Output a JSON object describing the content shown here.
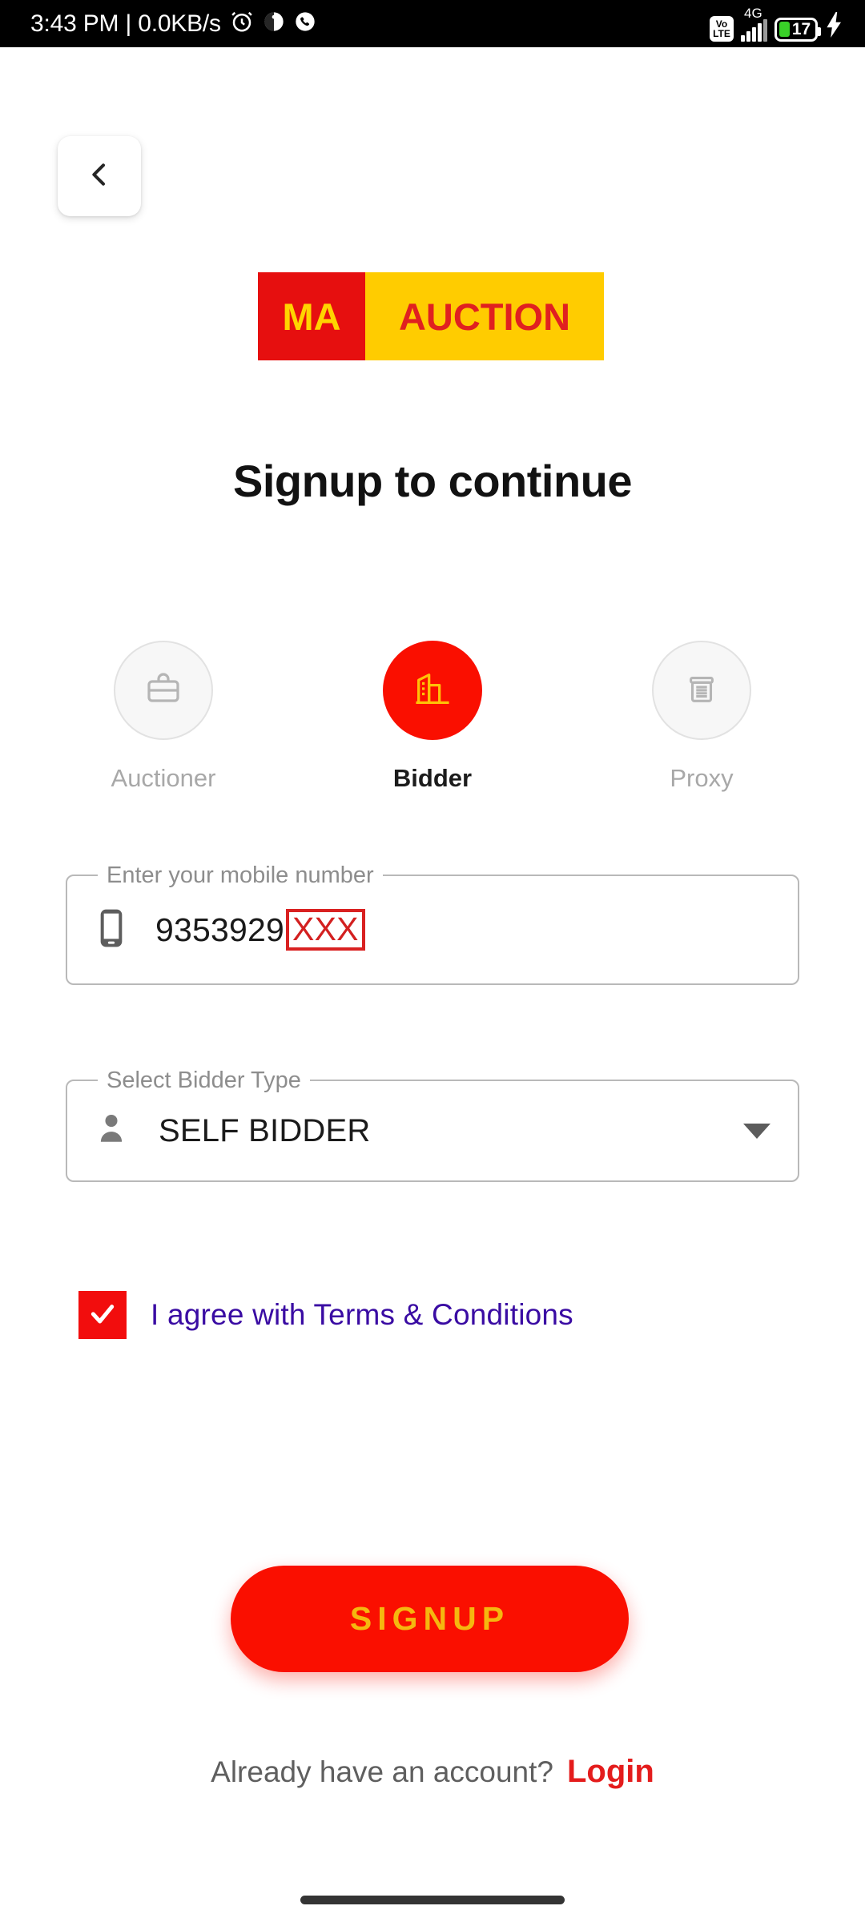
{
  "status_bar": {
    "time": "3:43 PM",
    "separator": "|",
    "network_speed": "0.0KB/s",
    "icons_left": [
      "alarm-icon",
      "sound-mode-icon",
      "phone-call-icon"
    ],
    "volte_top": "Vo",
    "volte_bottom": "LTE",
    "network_type": "4G",
    "battery_percent": "17",
    "battery_charging": true,
    "background": "#000000",
    "foreground": "#ffffff",
    "battery_fill_color": "#39d128"
  },
  "nav": {
    "back_icon": "chevron-left-icon"
  },
  "brand": {
    "logo_left_text": "MA",
    "logo_right_text": "AUCTION",
    "logo_left_bg": "#e60f0f",
    "logo_left_fg": "#ffd400",
    "logo_right_bg": "#ffcc00",
    "logo_right_fg": "#e02020"
  },
  "header": {
    "title": "Signup to continue"
  },
  "role_selector": {
    "selected": "Bidder",
    "accent_color": "#fa0f00",
    "icon_selected_color": "#ffc107",
    "options": [
      {
        "label": "Auctioner",
        "icon": "briefcase-icon",
        "selected": false
      },
      {
        "label": "Bidder",
        "icon": "building-icon",
        "selected": true
      },
      {
        "label": "Proxy",
        "icon": "document-icon",
        "selected": false
      }
    ]
  },
  "form": {
    "mobile": {
      "legend": "Enter your mobile number",
      "icon": "smartphone-icon",
      "value": "9353929",
      "redacted_value": "XXX",
      "redaction_color": "#d92121",
      "placeholder": "Enter your mobile number"
    },
    "bidder_type": {
      "legend": "Select Bidder Type",
      "icon": "person-icon",
      "value": "SELF BIDDER",
      "caret_icon": "chevron-down-icon",
      "options": [
        "SELF BIDDER"
      ]
    },
    "terms": {
      "checked": true,
      "label": "I agree with Terms & Conditions",
      "label_color": "#3a0ca3",
      "checkbox_color": "#f20d0d",
      "check_icon": "check-icon"
    }
  },
  "actions": {
    "signup_label": "SIGNUP",
    "signup_bg": "#fa0f00",
    "signup_fg": "#f5b70f",
    "login_prompt": "Already have an account?",
    "login_label": "Login",
    "login_color": "#e41c1c"
  },
  "system": {
    "home_indicator": "home-gesture-bar"
  }
}
